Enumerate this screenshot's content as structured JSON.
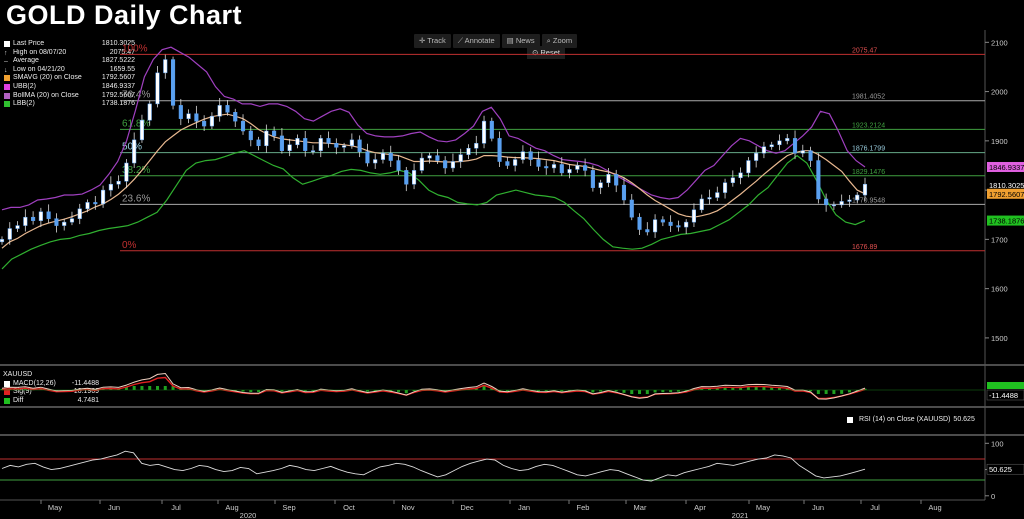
{
  "title": "GOLD Daily Chart",
  "toolbar": {
    "track": "Track",
    "annotate": "Annotate",
    "news": "News",
    "zoom": "Zoom",
    "reset": "Reset"
  },
  "legend": {
    "last_price": {
      "label": "Last Price",
      "value": "1810.3025"
    },
    "high": {
      "label": "High on 08/07/20",
      "value": "2075.47"
    },
    "average": {
      "label": "Average",
      "value": "1827.5222"
    },
    "low": {
      "label": "Low on 04/21/20",
      "value": "1659.55"
    },
    "smavg": {
      "label": "SMAVG (20)  on Close",
      "value": "1792.5607",
      "color": "#f0a030"
    },
    "ubb": {
      "label": "UBB(2)",
      "value": "1846.9337",
      "color": "#e040e0"
    },
    "bollma": {
      "label": "BollMA (20)  on Close",
      "value": "1792.5607",
      "color": "#b060c0"
    },
    "lbb": {
      "label": "LBB(2)",
      "value": "1738.1876",
      "color": "#30c030"
    }
  },
  "macd_legend": {
    "symbol": "XAUUSD",
    "macd": {
      "label": "MACD(12,26)",
      "value": "-11.4488"
    },
    "sig": {
      "label": "Sig(9)",
      "value": "-16.1969"
    },
    "diff": {
      "label": "Diff",
      "value": "4.7481"
    }
  },
  "rsi_legend": {
    "label": "RSI (14)  on Close (XAUUSD)",
    "value": "50.625"
  },
  "colors": {
    "candle": "#5aa0f0",
    "sma": "#e8b890",
    "upper_band": "#a040c0",
    "lower_band": "#30b030",
    "fib_red": "#c03030",
    "fib_green": "#40a040",
    "tag_price": "#ffffff",
    "tag_sma": "#f0a030",
    "tag_ubb": "#e060e0",
    "tag_lbb": "#20c020"
  },
  "chart_data": [
    {
      "type": "line",
      "subtype": "candlestick-with-bollinger",
      "title": "GOLD Daily Chart",
      "x_tick_labels": [
        "May",
        "Jun",
        "Jul",
        "Aug",
        "Sep",
        "Oct",
        "Nov",
        "Dec",
        "Jan",
        "Feb",
        "Mar",
        "Apr",
        "May",
        "Jun",
        "Jul",
        "Aug"
      ],
      "year_labels": [
        "2020",
        "2021"
      ],
      "y_tick_labels": [
        "1500",
        "1600",
        "1700",
        "1800",
        "1900",
        "2000",
        "2100"
      ],
      "ylim": [
        1445,
        2125
      ],
      "fib_levels": [
        {
          "label": "100%",
          "value": "2075.47",
          "price": 2075.47,
          "color": "red"
        },
        {
          "label": "76.4%",
          "value": "1981.4052",
          "price": 1981.4052,
          "color": "gray"
        },
        {
          "label": "61.8%",
          "value": "1923.2124",
          "price": 1923.2124,
          "color": "green"
        },
        {
          "label": "50%",
          "value": "1876.1799",
          "price": 1876.1799,
          "color": "cyan"
        },
        {
          "label": "38.2%",
          "value": "1829.1476",
          "price": 1829.1476,
          "color": "green"
        },
        {
          "label": "23.6%",
          "value": "1770.9548",
          "price": 1770.9548,
          "color": "gray"
        },
        {
          "label": "0%",
          "value": "1676.89",
          "price": 1676.89,
          "color": "red"
        }
      ],
      "close_series": [
        1700,
        1722,
        1728,
        1745,
        1738,
        1756,
        1742,
        1728,
        1735,
        1742,
        1762,
        1775,
        1772,
        1800,
        1812,
        1818,
        1855,
        1902,
        1942,
        1975,
        2038,
        2065,
        1972,
        1945,
        1955,
        1940,
        1930,
        1950,
        1972,
        1958,
        1940,
        1920,
        1902,
        1890,
        1920,
        1910,
        1880,
        1892,
        1905,
        1880,
        1880,
        1905,
        1895,
        1887,
        1890,
        1902,
        1878,
        1855,
        1862,
        1875,
        1860,
        1840,
        1812,
        1840,
        1865,
        1870,
        1860,
        1845,
        1858,
        1872,
        1885,
        1895,
        1940,
        1905,
        1858,
        1850,
        1862,
        1878,
        1862,
        1848,
        1845,
        1852,
        1835,
        1842,
        1850,
        1840,
        1805,
        1815,
        1832,
        1810,
        1780,
        1745,
        1720,
        1715,
        1740,
        1735,
        1728,
        1725,
        1735,
        1760,
        1782,
        1785,
        1795,
        1815,
        1825,
        1835,
        1860,
        1875,
        1888,
        1892,
        1900,
        1905,
        1875,
        1880,
        1860,
        1782,
        1770,
        1770,
        1777,
        1780,
        1790,
        1812
      ],
      "sma20_series": [
        1682,
        1695,
        1702,
        1712,
        1720,
        1728,
        1733,
        1737,
        1741,
        1746,
        1752,
        1758,
        1766,
        1772,
        1781,
        1792,
        1806,
        1822,
        1840,
        1860,
        1880,
        1898,
        1910,
        1922,
        1930,
        1937,
        1944,
        1949,
        1952,
        1954,
        1950,
        1945,
        1935,
        1923,
        1915,
        1908,
        1904,
        1902,
        1900,
        1898,
        1896,
        1896,
        1895,
        1894,
        1892,
        1890,
        1886,
        1880,
        1876,
        1874,
        1872,
        1870,
        1864,
        1858,
        1858,
        1859,
        1858,
        1857,
        1857,
        1858,
        1860,
        1863,
        1870,
        1870,
        1869,
        1867,
        1866,
        1866,
        1865,
        1864,
        1862,
        1860,
        1856,
        1852,
        1850,
        1848,
        1844,
        1840,
        1837,
        1832,
        1825,
        1815,
        1803,
        1790,
        1779,
        1770,
        1761,
        1752,
        1747,
        1745,
        1748,
        1752,
        1758,
        1768,
        1780,
        1792,
        1805,
        1818,
        1832,
        1845,
        1858,
        1870,
        1876,
        1880,
        1880,
        1872,
        1862,
        1850,
        1838,
        1818,
        1800,
        1792.5607
      ],
      "upper_band_series": [
        1760,
        1765,
        1765,
        1770,
        1780,
        1782,
        1785,
        1790,
        1790,
        1792,
        1800,
        1810,
        1832,
        1858,
        1900,
        1962,
        2030,
        2065,
        2085,
        2090,
        2080,
        2070,
        2055,
        2040,
        2010,
        1990,
        1985,
        1975,
        1975,
        1970,
        1975,
        1975,
        1970,
        1960,
        1945,
        1940,
        1950,
        1960,
        1965,
        1958,
        1932,
        1915,
        1910,
        1908,
        1908,
        1910,
        1915,
        1918,
        1908,
        1900,
        1898,
        1902,
        1915,
        1930,
        1960,
        1968,
        1945,
        1910,
        1905,
        1895,
        1885,
        1880,
        1870,
        1862,
        1860,
        1858,
        1855,
        1850,
        1840,
        1830,
        1820,
        1810,
        1800,
        1790,
        1785,
        1782,
        1785,
        1800,
        1820,
        1840,
        1850,
        1870,
        1890,
        1905,
        1900,
        1890,
        1880,
        1875,
        1880,
        1895,
        1910,
        1928,
        1960,
        1955,
        1920,
        1880,
        1860,
        1846.9337
      ],
      "lower_band_series": [
        1640,
        1660,
        1670,
        1680,
        1688,
        1695,
        1700,
        1702,
        1708,
        1712,
        1718,
        1722,
        1725,
        1728,
        1735,
        1745,
        1755,
        1780,
        1810,
        1840,
        1855,
        1860,
        1862,
        1868,
        1875,
        1880,
        1870,
        1860,
        1850,
        1843,
        1825,
        1812,
        1818,
        1825,
        1830,
        1838,
        1842,
        1840,
        1835,
        1832,
        1835,
        1840,
        1835,
        1820,
        1800,
        1790,
        1785,
        1775,
        1772,
        1770,
        1775,
        1790,
        1795,
        1800,
        1795,
        1790,
        1788,
        1785,
        1775,
        1758,
        1742,
        1720,
        1700,
        1685,
        1682,
        1680,
        1682,
        1690,
        1700,
        1705,
        1710,
        1712,
        1716,
        1720,
        1730,
        1740,
        1755,
        1770,
        1790,
        1805,
        1830,
        1855,
        1870,
        1855,
        1820,
        1780,
        1750,
        1735,
        1730,
        1738.1876
      ]
    },
    {
      "type": "line",
      "title": "MACD",
      "series_names": [
        "MACD(12,26)",
        "Sig(9)",
        "Diff"
      ],
      "last_values": {
        "macd": -11.4488,
        "sig": -16.1969,
        "diff": 4.7481
      },
      "y_tick_labels": [
        "-11.4488"
      ]
    },
    {
      "type": "line",
      "title": "RSI (14)",
      "y_tick_labels": [
        "0",
        "50",
        "100"
      ],
      "ylim": [
        -8,
        112
      ],
      "overbought": 70,
      "oversold": 30,
      "last_value": 50.625,
      "values": [
        52,
        58,
        55,
        60,
        62,
        55,
        50,
        52,
        56,
        60,
        64,
        68,
        70,
        74,
        78,
        85,
        82,
        62,
        58,
        60,
        55,
        50,
        48,
        52,
        58,
        56,
        50,
        46,
        48,
        54,
        52,
        42,
        45,
        48,
        52,
        58,
        55,
        50,
        48,
        52,
        56,
        50,
        45,
        42,
        40,
        48,
        55,
        58,
        62,
        60,
        55,
        48,
        42,
        36,
        40,
        48,
        56,
        62,
        66,
        70,
        68,
        58,
        52,
        48,
        50,
        56,
        60,
        58,
        52,
        46,
        40,
        38,
        42,
        46,
        50,
        48,
        42,
        36,
        30,
        28,
        34,
        40,
        38,
        44,
        48,
        52,
        56,
        62,
        60,
        58,
        62,
        66,
        70,
        72,
        78,
        76,
        72,
        58,
        48,
        38,
        34,
        36,
        38,
        42,
        46,
        50.625
      ]
    }
  ]
}
